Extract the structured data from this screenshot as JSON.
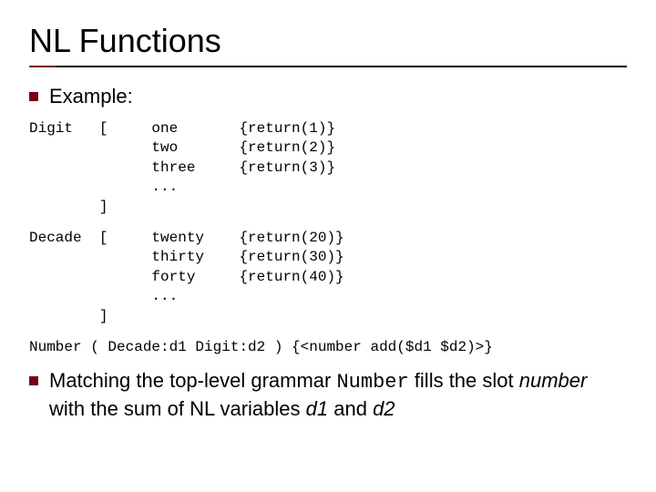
{
  "title": "NL Functions",
  "example_label": "Example:",
  "code": {
    "digit_block": "Digit   [     one       {return(1)}\n              two       {return(2)}\n              three     {return(3)}\n              ...\n        ]",
    "decade_block": "Decade  [     twenty    {return(20)}\n              thirty    {return(30)}\n              forty     {return(40)}\n              ...\n        ]",
    "number_line": "Number ( Decade:d1 Digit:d2 ) {<number add($d1 $d2)>}"
  },
  "matching": {
    "prefix": "Matching the top-level grammar ",
    "code1": "Number",
    "mid1": " fills the slot ",
    "slot": "number",
    "mid2": " with the sum of NL variables ",
    "var1": "d1",
    "and": " and ",
    "var2": "d2"
  }
}
